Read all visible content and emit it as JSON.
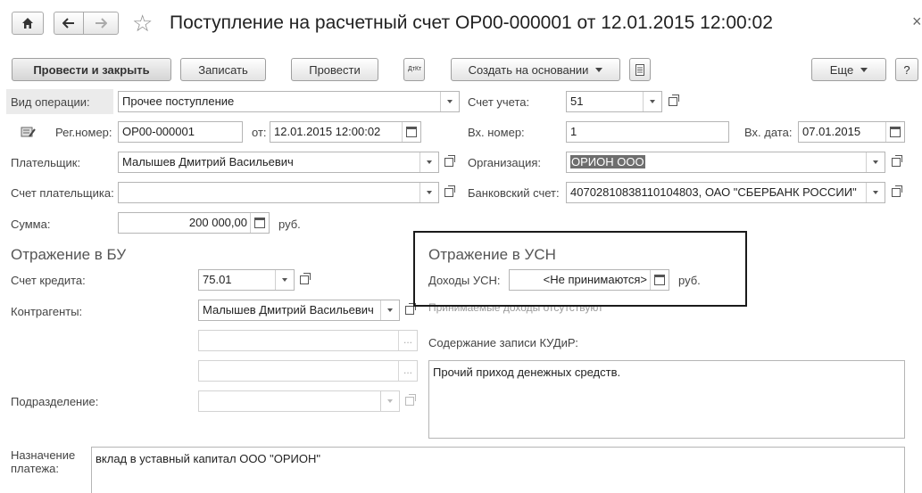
{
  "window": {
    "title": "Поступление на расчетный счет ОР00-000001 от 12.01.2015 12:00:02",
    "close_symbol": "×"
  },
  "toolbar": {
    "post_close": "Провести и закрыть",
    "save": "Записать",
    "post": "Провести",
    "dt_kt": "ДтКт",
    "create_based": "Создать на основании",
    "more": "Еще",
    "help": "?"
  },
  "form": {
    "operation_type_label": "Вид операции:",
    "operation_type_value": "Прочее поступление",
    "account_label": "Счет учета:",
    "account_value": "51",
    "reg_number_label": "Рег.номер:",
    "reg_number_value": "ОР00-000001",
    "from_label": "от:",
    "from_value": "12.01.2015 12:00:02",
    "in_number_label": "Вх. номер:",
    "in_number_value": "1",
    "in_date_label": "Вх. дата:",
    "in_date_value": "07.01.2015",
    "payer_label": "Плательщик:",
    "payer_value": "Малышев Дмитрий Васильевич",
    "org_label": "Организация:",
    "org_value": "ОРИОН ООО",
    "payer_account_label": "Счет плательщика:",
    "payer_account_value": "",
    "bank_account_label": "Банковский счет:",
    "bank_account_value": "40702810838110104803, ОАО \"СБЕРБАНК РОССИИ\"",
    "sum_label": "Сумма:",
    "sum_value": "200 000,00",
    "currency": "руб."
  },
  "bu": {
    "section_title": "Отражение в БУ",
    "credit_account_label": "Счет кредита:",
    "credit_account_value": "75.01",
    "counterparties_label": "Контрагенты:",
    "counterparties_value": "Малышев Дмитрий Васильевич",
    "division_label": "Подразделение:"
  },
  "usn": {
    "section_title": "Отражение в УСН",
    "income_label": "Доходы УСН:",
    "income_value": "<Не принимаются>",
    "currency": "руб.",
    "hint": "Принимаемые доходы отсутствуют",
    "kudir_label": "Содержание записи КУДиР:",
    "kudir_value": "Прочий приход денежных средств."
  },
  "purpose": {
    "label_line1": "Назначение",
    "label_line2": "платежа:",
    "value": "вклад в уставный капитал ООО \"ОРИОН\""
  }
}
